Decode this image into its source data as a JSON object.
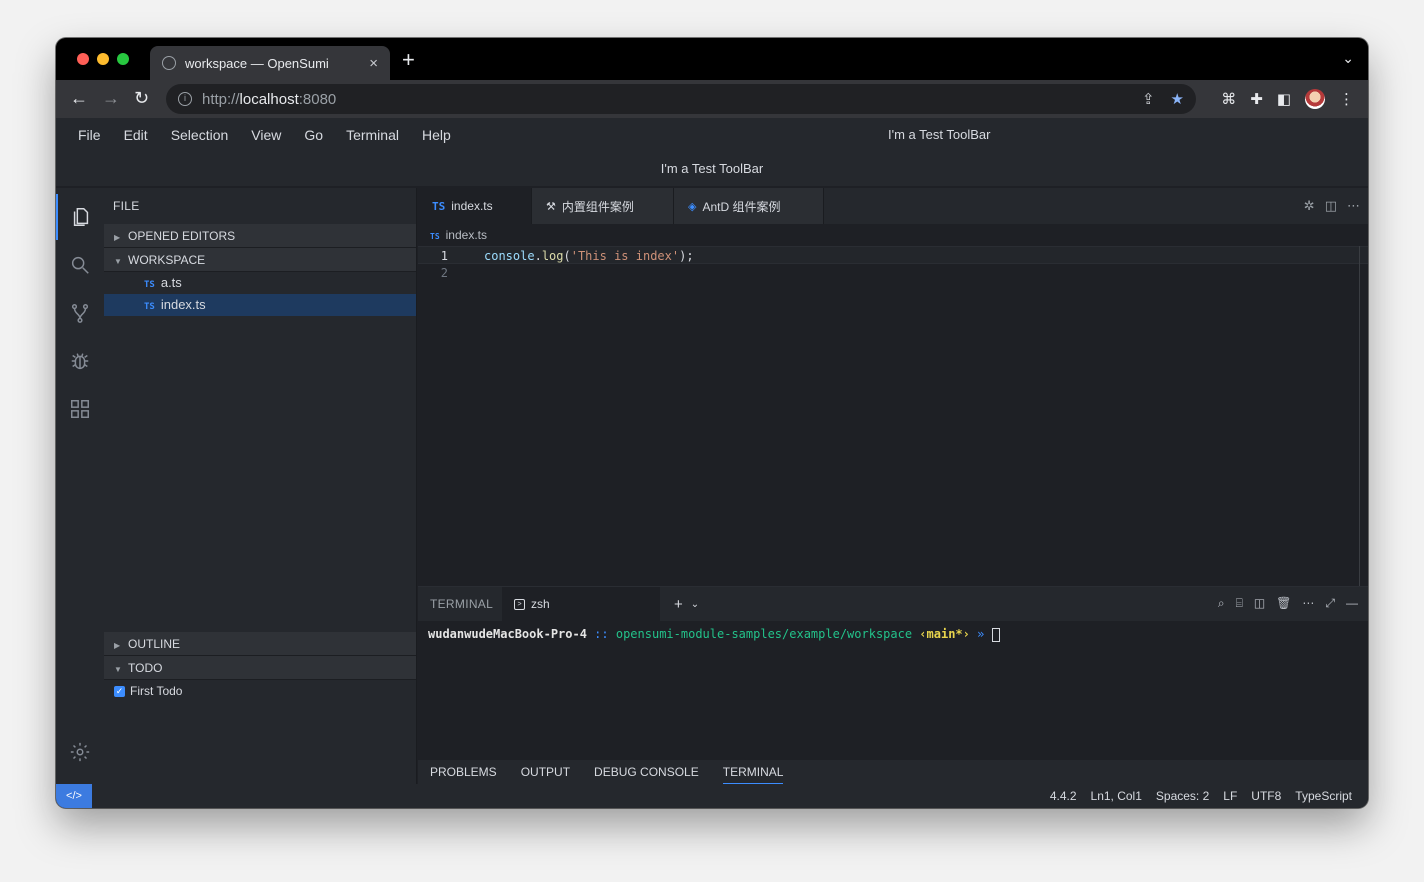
{
  "browser": {
    "tab_title": "workspace — OpenSumi",
    "tab_close": "×",
    "new_tab": "+",
    "tabs_menu": "⌄",
    "url_scheme": "http://",
    "url_host": "localhost",
    "url_port": ":8080",
    "colors": {
      "traffic_red": "#ff5f57",
      "traffic_yellow": "#febc2e",
      "traffic_green": "#28c840"
    }
  },
  "menubar": {
    "items": [
      "File",
      "Edit",
      "Selection",
      "View",
      "Go",
      "Terminal",
      "Help"
    ],
    "toolbar_right": "I'm a Test ToolBar",
    "toolbar_center": "I'm a Test ToolBar"
  },
  "sidebar": {
    "title": "FILE",
    "opened_editors": "OPENED EDITORS",
    "workspace": "WORKSPACE",
    "files": [
      {
        "badge": "TS",
        "name": "a.ts"
      },
      {
        "badge": "TS",
        "name": "index.ts"
      }
    ],
    "outline": "OUTLINE",
    "todo": "TODO",
    "todo_items": [
      {
        "label": "First Todo",
        "checked": true
      }
    ]
  },
  "editor": {
    "tabs": [
      {
        "icon": "TS",
        "label": "index.ts"
      },
      {
        "icon": "⚒",
        "label": "内置组件案例"
      },
      {
        "icon": "◈",
        "label": "AntD 组件案例"
      }
    ],
    "breadcrumb_badge": "TS",
    "breadcrumb": "index.ts",
    "lines": [
      {
        "num": "1",
        "obj": "console",
        "dot": ".",
        "fn": "log",
        "open": "(",
        "str": "'This is index'",
        "close": ");"
      },
      {
        "num": "2"
      }
    ]
  },
  "terminal": {
    "title": "TERMINAL",
    "tab_label": "zsh",
    "add": "+",
    "chevron": "⌄",
    "host": "wudanwudeMacBook-Pro-4",
    "sep": " :: ",
    "path": "opensumi-module-samples/example/workspace",
    "branch": " ‹main*›",
    "prompt": " » "
  },
  "panel_tabs": [
    "PROBLEMS",
    "OUTPUT",
    "DEBUG CONSOLE",
    "TERMINAL"
  ],
  "statusbar": {
    "remote": "</>",
    "version": "4.4.2",
    "position": "Ln1, Col1",
    "spaces": "Spaces: 2",
    "eol": "LF",
    "encoding": "UTF8",
    "language": "TypeScript"
  },
  "icons": {
    "activity": [
      "files-icon",
      "search-icon",
      "source-control-icon",
      "debug-icon",
      "extensions-icon"
    ],
    "accent": "#3c8dff"
  }
}
